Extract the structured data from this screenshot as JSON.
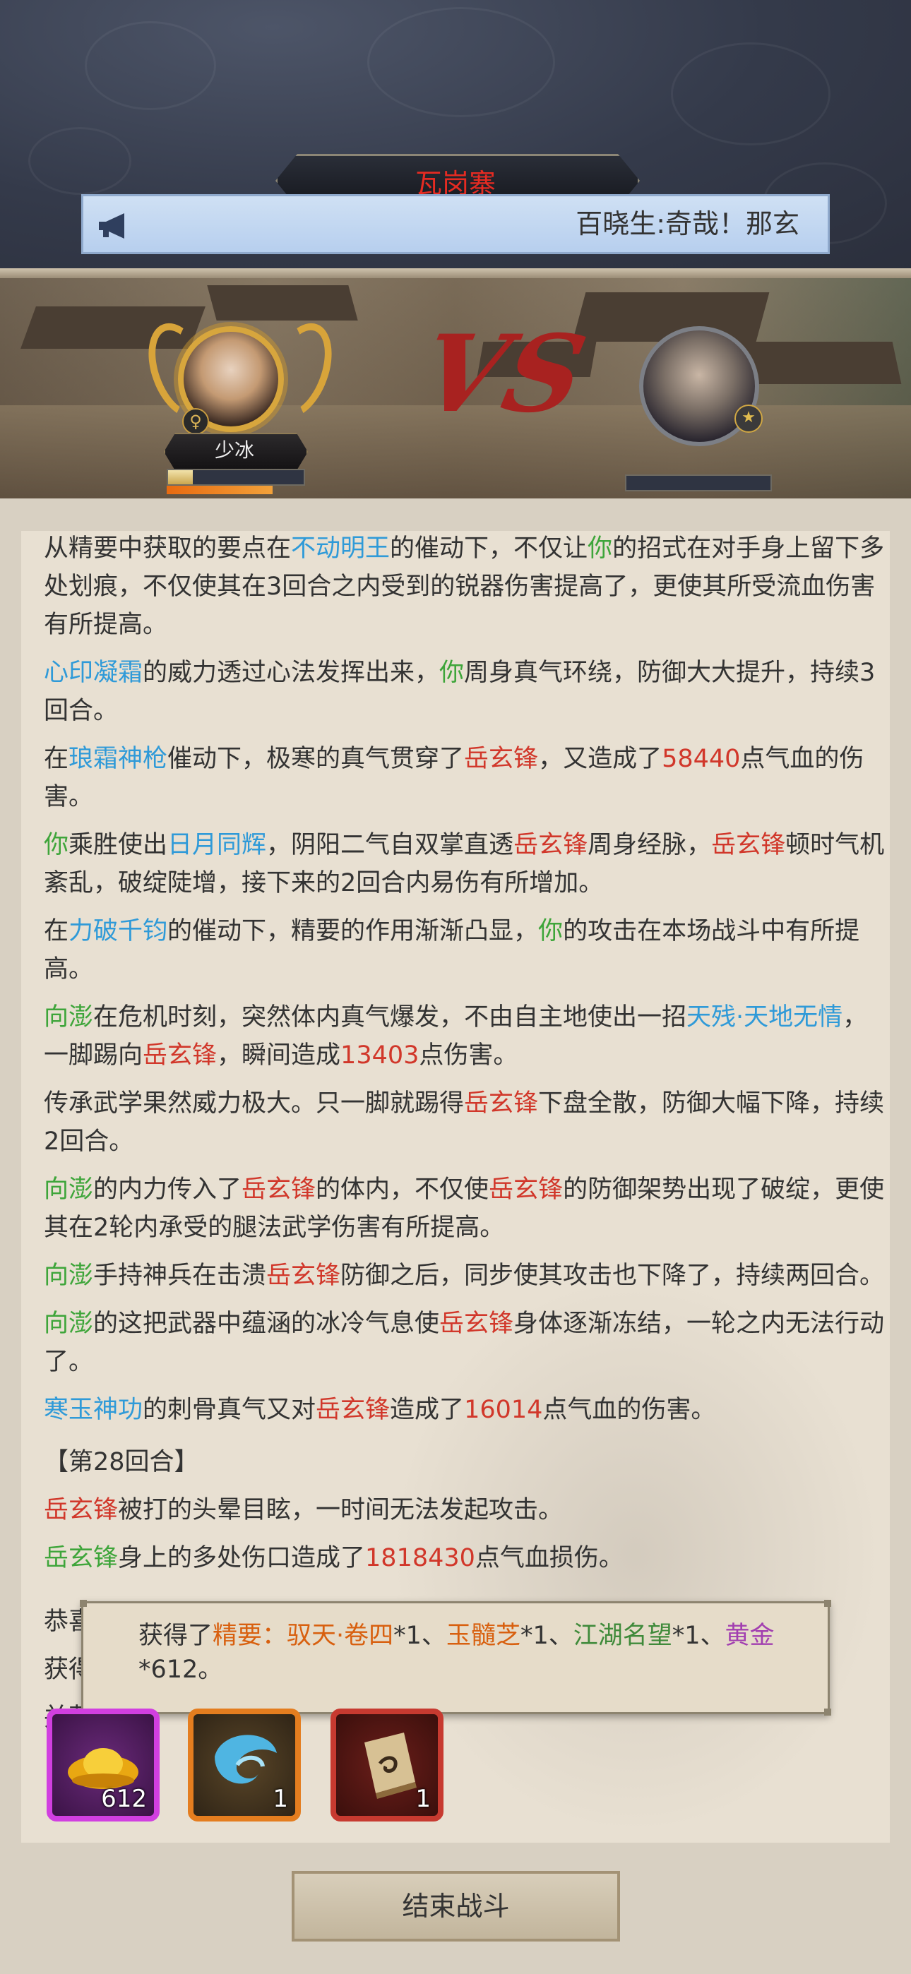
{
  "header": {
    "location": "瓦岗寨",
    "broadcast": "百晓生:奇哉！那玄",
    "megaphone_icon": "megaphone-icon"
  },
  "battle": {
    "player_name": "少冰",
    "player_gender_icon": "female-icon",
    "player_hp_fraction": 0.18,
    "vs_text": "VS",
    "enemy_hp_fraction": 0.0
  },
  "log": [
    [
      [
        "t",
        "从精要中获取的要点在"
      ],
      [
        "b",
        "不动明王"
      ],
      [
        "t",
        "的催动下，不仅让"
      ],
      [
        "g",
        "你"
      ],
      [
        "t",
        "的招式在对手身上留下多处划痕，不仅使其在3回合之内受到的锐器伤害提高了，更使其所受流血伤害有所提高。"
      ]
    ],
    [
      [
        "b",
        "心印凝霜"
      ],
      [
        "t",
        "的威力透过心法发挥出来，"
      ],
      [
        "g",
        "你"
      ],
      [
        "t",
        "周身真气环绕，防御大大提升，持续3回合。"
      ]
    ],
    [
      [
        "t",
        "在"
      ],
      [
        "b",
        "琅霜神枪"
      ],
      [
        "t",
        "催动下，极寒的真气贯穿了"
      ],
      [
        "r",
        "岳玄锋"
      ],
      [
        "t",
        "，又造成了"
      ],
      [
        "n",
        "58440"
      ],
      [
        "t",
        "点气血的伤害。"
      ]
    ],
    [
      [
        "g",
        "你"
      ],
      [
        "t",
        "乘胜使出"
      ],
      [
        "b",
        "日月同辉"
      ],
      [
        "t",
        "，阴阳二气自双掌直透"
      ],
      [
        "r",
        "岳玄锋"
      ],
      [
        "t",
        "周身经脉，"
      ],
      [
        "r",
        "岳玄锋"
      ],
      [
        "t",
        "顿时气机紊乱，破绽陡增，接下来的2回合内易伤有所增加。"
      ]
    ],
    [
      [
        "t",
        "在"
      ],
      [
        "b",
        "力破千钧"
      ],
      [
        "t",
        "的催动下，精要的作用渐渐凸显，"
      ],
      [
        "g",
        "你"
      ],
      [
        "t",
        "的攻击在本场战斗中有所提高。"
      ]
    ],
    [
      [
        "g",
        "向澎"
      ],
      [
        "t",
        "在危机时刻，突然体内真气爆发，不由自主地使出一招"
      ],
      [
        "b",
        "天残·天地无情"
      ],
      [
        "t",
        "，一脚踢向"
      ],
      [
        "r",
        "岳玄锋"
      ],
      [
        "t",
        "，瞬间造成"
      ],
      [
        "n",
        "13403"
      ],
      [
        "t",
        "点伤害。"
      ]
    ],
    [
      [
        "t",
        "传承武学果然威力极大。只一脚就踢得"
      ],
      [
        "r",
        "岳玄锋"
      ],
      [
        "t",
        "下盘全散，防御大幅下降，持续2回合。"
      ]
    ],
    [
      [
        "g",
        "向澎"
      ],
      [
        "t",
        "的内力传入了"
      ],
      [
        "r",
        "岳玄锋"
      ],
      [
        "t",
        "的体内，不仅使"
      ],
      [
        "r",
        "岳玄锋"
      ],
      [
        "t",
        "的防御架势出现了破绽，更使其在2轮内承受的腿法武学伤害有所提高。"
      ]
    ],
    [
      [
        "g",
        "向澎"
      ],
      [
        "t",
        "手持神兵在击溃"
      ],
      [
        "r",
        "岳玄锋"
      ],
      [
        "t",
        "防御之后，同步使其攻击也下降了，持续两回合。"
      ]
    ],
    [
      [
        "g",
        "向澎"
      ],
      [
        "t",
        "的这把武器中蕴涵的冰冷气息使"
      ],
      [
        "r",
        "岳玄锋"
      ],
      [
        "t",
        "身体逐渐冻结，一轮之内无法行动了。"
      ]
    ],
    [
      [
        "b",
        "寒玉神功"
      ],
      [
        "t",
        "的刺骨真气又对"
      ],
      [
        "r",
        "岳玄锋"
      ],
      [
        "t",
        "造成了"
      ],
      [
        "n",
        "16014"
      ],
      [
        "t",
        "点气血的伤害。"
      ]
    ]
  ],
  "round": {
    "label": "【第28回合】",
    "lines": [
      [
        [
          "r",
          "岳玄锋"
        ],
        [
          "t",
          "被打的头晕目眩，一时间无法发起攻击。"
        ]
      ],
      [
        [
          "g",
          "岳玄锋"
        ],
        [
          "t",
          "身上的多处伤口造成了"
        ],
        [
          "n",
          "1818430"
        ],
        [
          "t",
          "点气血损伤。"
        ]
      ]
    ]
  },
  "victory": [
    [
      "t",
      "恭喜你，你战胜了"
    ],
    [
      "r",
      "岳玄锋"
    ],
    [
      "t",
      "。"
    ]
  ],
  "reward_intro": [
    "获得",
    "并获"
  ],
  "tooltip": {
    "prefix": "获得了",
    "items": [
      {
        "text": "精要：驭天·卷四",
        "color": "orange",
        "qty": "*1、"
      },
      {
        "text": "玉髓芝",
        "color": "orange",
        "qty": "*1、"
      },
      {
        "text": "江湖名望",
        "color": "green",
        "qty": "*1、"
      },
      {
        "text": "黄金",
        "color": "purple",
        "qty": "*612。"
      }
    ]
  },
  "items": [
    {
      "name": "gold-ingot-icon",
      "count": "612",
      "rarity_color": "#d13fe0"
    },
    {
      "name": "lingzhi-icon",
      "count": "1",
      "rarity_color": "#e47d1f"
    },
    {
      "name": "manual-book-icon",
      "count": "1",
      "rarity_color": "#c73a30"
    }
  ],
  "end_button": "结束战斗"
}
